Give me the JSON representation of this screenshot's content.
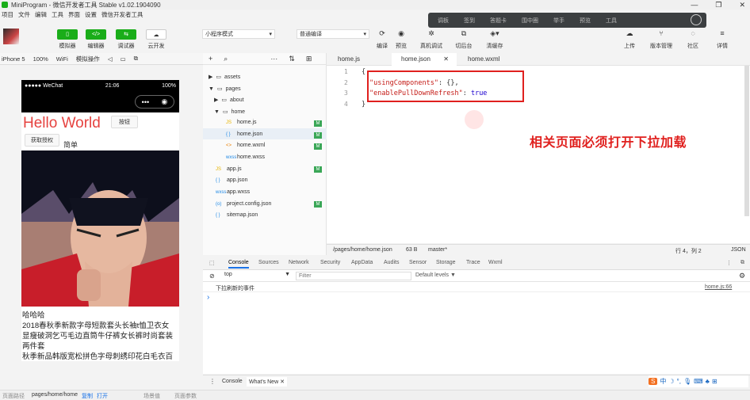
{
  "window": {
    "title": "MiniProgram - 微信开发者工具 Stable v1.02.1904090",
    "controls": [
      "—",
      "❐",
      "✕"
    ]
  },
  "menu": [
    "项目",
    "文件",
    "编辑",
    "工具",
    "界面",
    "设置",
    "微信开发者工具"
  ],
  "floatbar": [
    "调板",
    "签到",
    "答题卡",
    "围中圈",
    "举手",
    "预览",
    "工具"
  ],
  "toolbar": {
    "left_buttons": [
      "模拟器",
      "编辑器",
      "调试器",
      "云开发"
    ],
    "mode_select": "小程序模式",
    "compile_select": "普通编译",
    "mid_labels": [
      "编译",
      "预览",
      "真机调试",
      "切后台",
      "清缓存"
    ],
    "right_labels": [
      "上传",
      "版本管理",
      "社区",
      "详情"
    ]
  },
  "simbar": {
    "device": "iPhone 5",
    "zoom": "100%",
    "network": "WiFi",
    "ops": "模拟操作"
  },
  "phone": {
    "carrier": "●●●●● WeChat",
    "time": "21:06",
    "battery": "100%",
    "hello": "Hello World",
    "buy_btn": "按钮",
    "auth_btn": "获取授权",
    "simple": "简单",
    "lines": [
      "哈哈哈",
      "2018春秋季新款字母短款套头长袖t恤卫衣女",
      "显瘦破洞乞丐毛边直筒牛仔裤女长裤时尚套装",
      "两件套",
      "秋季新品韩版宽松拼色字母刺绣印花白毛衣百"
    ]
  },
  "files": [
    {
      "name": "assets",
      "type": "folder",
      "arrow": "▶"
    },
    {
      "name": "pages",
      "type": "folder",
      "arrow": "▼"
    },
    {
      "name": "about",
      "type": "folder",
      "arrow": "▶"
    },
    {
      "name": "home",
      "type": "folder",
      "arrow": "▼"
    },
    {
      "name": "home.js",
      "type": "js",
      "badge": "M"
    },
    {
      "name": "home.json",
      "type": "json",
      "badge": "M"
    },
    {
      "name": "home.wxml",
      "type": "wxml",
      "badge": "M"
    },
    {
      "name": "home.wxss",
      "type": "wxss"
    },
    {
      "name": "app.js",
      "type": "js",
      "badge": "M"
    },
    {
      "name": "app.json",
      "type": "json"
    },
    {
      "name": "app.wxss",
      "type": "wxss"
    },
    {
      "name": "project.config.json",
      "type": "config",
      "badge": "M"
    },
    {
      "name": "sitemap.json",
      "type": "json"
    }
  ],
  "editor_tabs": [
    "home.js",
    "home.json",
    "home.wxml"
  ],
  "code": {
    "l1": "{",
    "l2_key": "\"usingComponents\"",
    "l2_rest": ": {},",
    "l3_key": "\"enablePullDownRefresh\"",
    "l3_colon": ": ",
    "l3_val": "true",
    "l4": "}"
  },
  "annotation": "相关页面必须打开下拉加载",
  "status": {
    "path": "/pages/home/home.json",
    "size": "63 B",
    "branch": "master*",
    "pos": "行 4，列 2",
    "lang": "JSON"
  },
  "devtools_tabs": [
    "Console",
    "Sources",
    "Network",
    "Security",
    "AppData",
    "Audits",
    "Sensor",
    "Storage",
    "Trace",
    "Wxml"
  ],
  "filter": {
    "context": "top",
    "placeholder": "Filter",
    "levels": "Default levels ▼"
  },
  "console": {
    "message": "下拉刷新的事件",
    "source": "home.js:66",
    "prompt": "›"
  },
  "drawer_tabs": [
    "Console",
    "What's New ✕"
  ],
  "bottom": {
    "label": "页面路径",
    "path": "pages/home/home",
    "copy": "复制",
    "open": "打开",
    "scene": "场景值",
    "params": "页面参数"
  },
  "ime": "中"
}
